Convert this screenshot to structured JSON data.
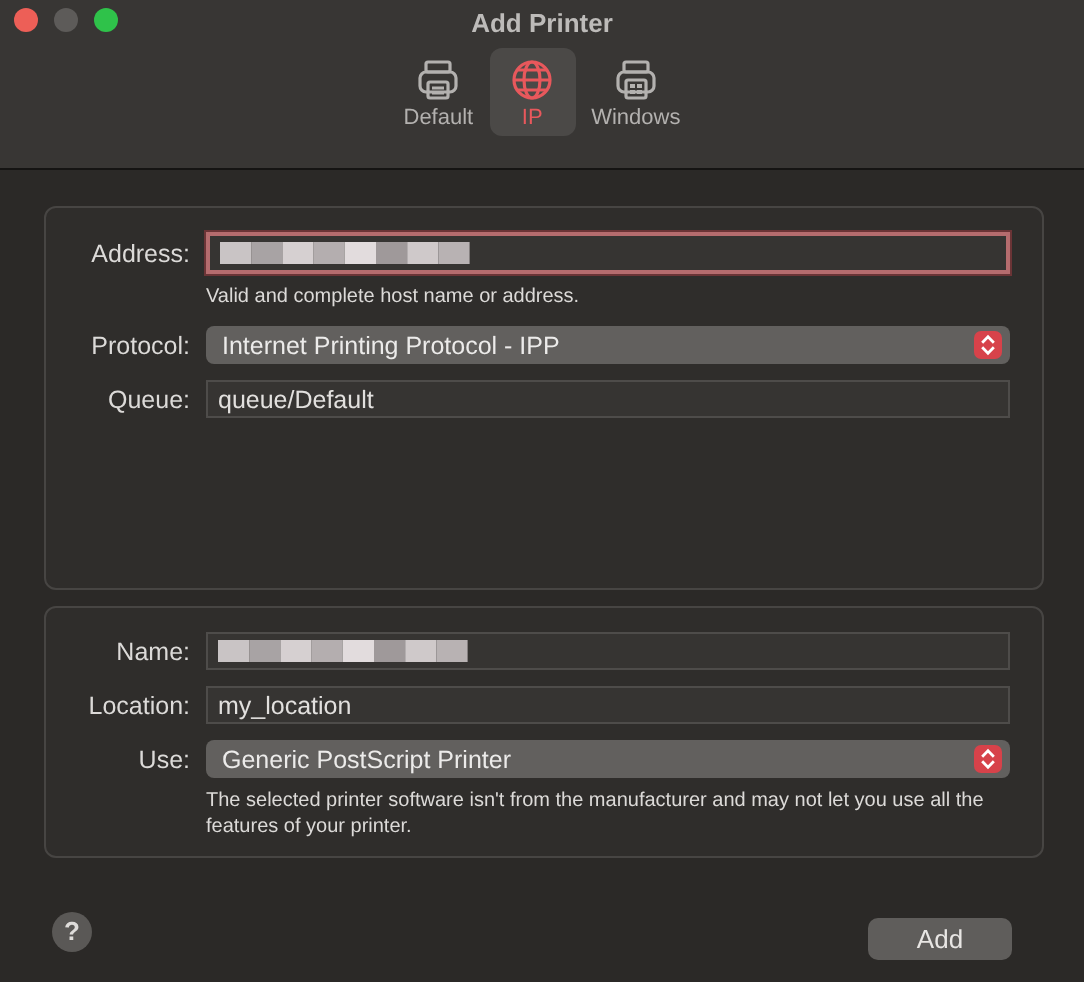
{
  "window": {
    "title": "Add Printer"
  },
  "tabs": [
    {
      "label": "Default",
      "kind": "printer",
      "selected": false
    },
    {
      "label": "IP",
      "kind": "globe",
      "selected": true
    },
    {
      "label": "Windows",
      "kind": "windows-printer",
      "selected": false
    }
  ],
  "connection": {
    "rows": [
      {
        "label": "Address:",
        "kind": "redacted",
        "invalid": true,
        "hint": "Valid and complete host name or address."
      },
      {
        "label": "Protocol:",
        "kind": "popup",
        "value": "Internet Printing Protocol - IPP"
      },
      {
        "label": "Queue:",
        "kind": "text",
        "value": "queue/Default"
      }
    ]
  },
  "details": {
    "rows": [
      {
        "label": "Name:",
        "kind": "redacted",
        "invalid": false
      },
      {
        "label": "Location:",
        "kind": "text",
        "value": "my_location"
      },
      {
        "label": "Use:",
        "kind": "popup",
        "value": "Generic PostScript Printer",
        "hint": "The selected printer software isn't from the manufacturer and may not let you use all the features of your printer."
      }
    ]
  },
  "help_button": {
    "label": "?"
  },
  "add_button": {
    "label": "Add"
  }
}
